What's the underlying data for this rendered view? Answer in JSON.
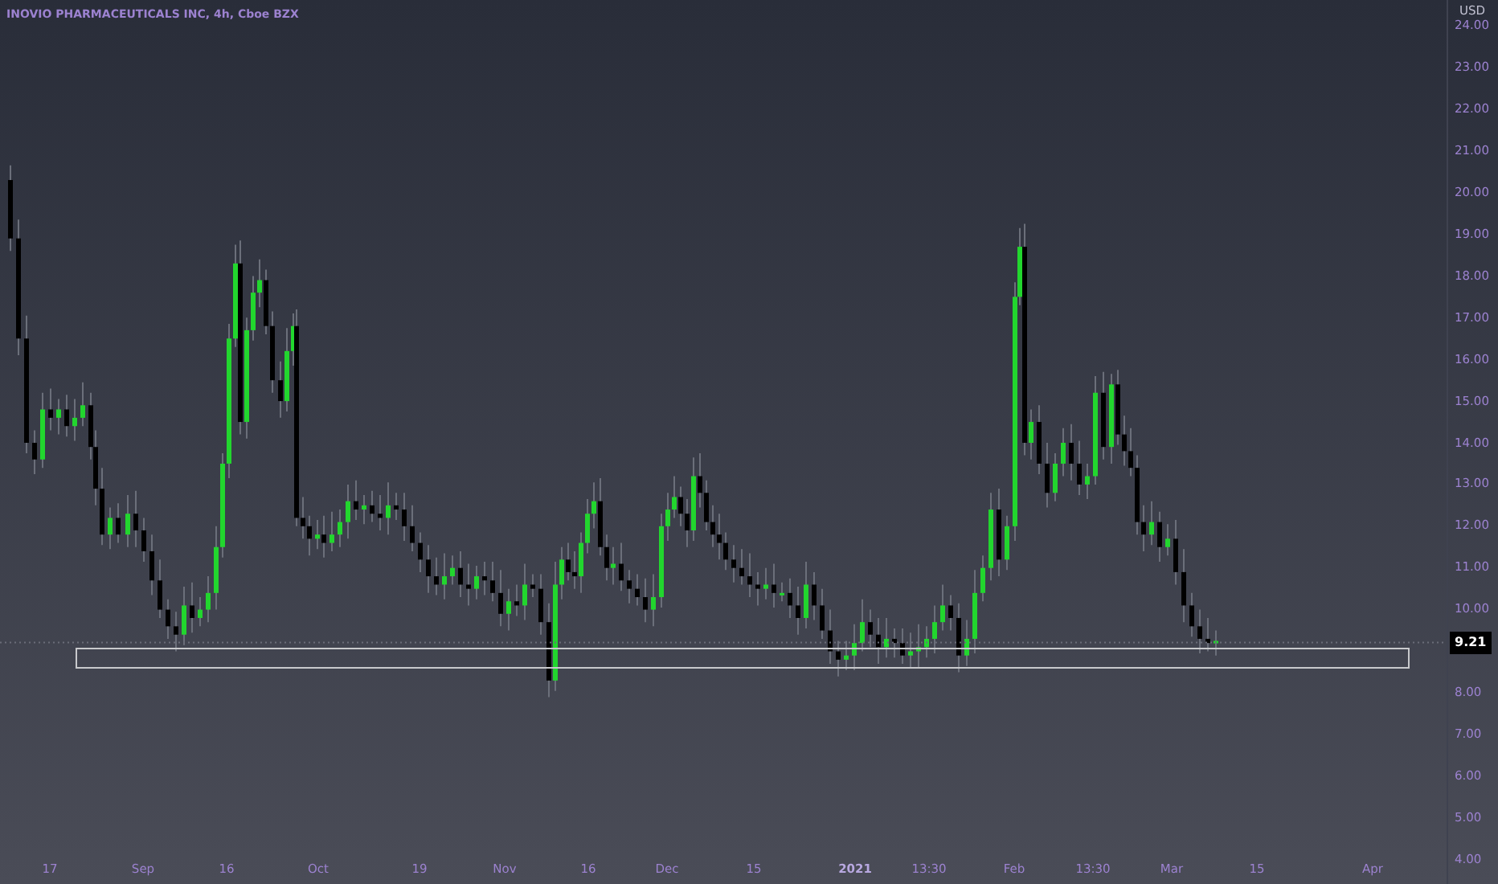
{
  "chart": {
    "title": "INOVIO PHARMACEUTICALS INC, 4h, Cboe BZX"
  },
  "price_axis": {
    "currency": "USD",
    "ticks": [
      "24.00",
      "23.00",
      "22.00",
      "21.00",
      "20.00",
      "19.00",
      "18.00",
      "17.00",
      "16.00",
      "15.00",
      "14.00",
      "13.00",
      "12.00",
      "11.00",
      "10.00",
      "8.00",
      "7.00",
      "6.00",
      "5.00",
      "4.00"
    ],
    "last_price": "9.21"
  },
  "time_axis": {
    "ticks": [
      {
        "label": "17",
        "kind": "regular"
      },
      {
        "label": "Sep",
        "kind": "regular"
      },
      {
        "label": "16",
        "kind": "regular"
      },
      {
        "label": "Oct",
        "kind": "regular"
      },
      {
        "label": "19",
        "kind": "regular"
      },
      {
        "label": "Nov",
        "kind": "regular"
      },
      {
        "label": "16",
        "kind": "regular"
      },
      {
        "label": "Dec",
        "kind": "regular"
      },
      {
        "label": "15",
        "kind": "regular"
      },
      {
        "label": "2021",
        "kind": "year"
      },
      {
        "label": "13:30",
        "kind": "regular"
      },
      {
        "label": "Feb",
        "kind": "regular"
      },
      {
        "label": "13:30",
        "kind": "regular"
      },
      {
        "label": "Mar",
        "kind": "regular"
      },
      {
        "label": "15",
        "kind": "regular"
      },
      {
        "label": "Apr",
        "kind": "regular"
      }
    ]
  }
}
